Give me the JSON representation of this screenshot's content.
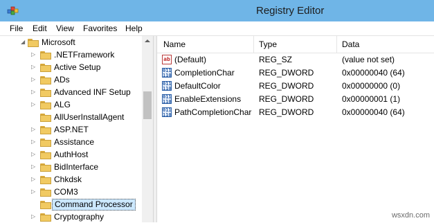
{
  "window": {
    "title": "Registry Editor"
  },
  "menu": [
    "File",
    "Edit",
    "View",
    "Favorites",
    "Help"
  ],
  "tree": {
    "root": "Microsoft",
    "children": [
      ".NETFramework",
      "Active Setup",
      "ADs",
      "Advanced INF Setup",
      "ALG",
      "AllUserInstallAgent",
      "ASP.NET",
      "Assistance",
      "AuthHost",
      "BidInterface",
      "Chkdsk",
      "COM3",
      "Command Processor",
      "Cryptography"
    ],
    "selected": "Command Processor"
  },
  "list": {
    "columns": [
      "Name",
      "Type",
      "Data"
    ],
    "rows": [
      {
        "icon": "string-value-icon",
        "name": "(Default)",
        "type": "REG_SZ",
        "data": "(value not set)"
      },
      {
        "icon": "dword-value-icon",
        "name": "CompletionChar",
        "type": "REG_DWORD",
        "data": "0x00000040 (64)"
      },
      {
        "icon": "dword-value-icon",
        "name": "DefaultColor",
        "type": "REG_DWORD",
        "data": "0x00000000 (0)"
      },
      {
        "icon": "dword-value-icon",
        "name": "EnableExtensions",
        "type": "REG_DWORD",
        "data": "0x00000001 (1)"
      },
      {
        "icon": "dword-value-icon",
        "name": "PathCompletionChar",
        "type": "REG_DWORD",
        "data": "0x00000040 (64)"
      }
    ]
  },
  "icons": {
    "sz_glyph": "ab",
    "dword_glyph": "011\n110"
  },
  "watermark": "wsxdn.com",
  "colors": {
    "titlebar": "#6fb5e7",
    "folder": "#f1ca62",
    "selection": "#cce8ff"
  }
}
